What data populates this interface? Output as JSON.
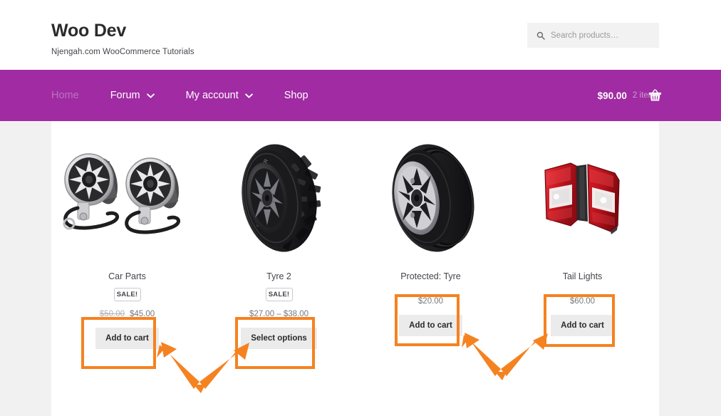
{
  "header": {
    "site_title": "Woo Dev",
    "tagline": "Njengah.com WooCommerce Tutorials",
    "search": {
      "icon": "search-icon",
      "placeholder": "Search products…",
      "value": ""
    }
  },
  "nav": {
    "background_color": "#a02ba3",
    "items": [
      {
        "label": "Home",
        "current": true,
        "has_dropdown": false
      },
      {
        "label": "Forum",
        "current": false,
        "has_dropdown": true
      },
      {
        "label": "My account",
        "current": false,
        "has_dropdown": true
      },
      {
        "label": "Shop",
        "current": false,
        "has_dropdown": false
      }
    ],
    "cart": {
      "amount": "$90.00",
      "count": "2 items",
      "icon": "shopping-basket-icon"
    }
  },
  "products": [
    {
      "title": "Car Parts",
      "image": "car-speakers",
      "on_sale": true,
      "sale_label": "SALE!",
      "price_old": "$50.00",
      "price": "$45.00",
      "button_label": "Add to cart"
    },
    {
      "title": "Tyre 2",
      "image": "offroad-tyre",
      "on_sale": true,
      "sale_label": "SALE!",
      "price_old": "",
      "price": "$27.00 – $38.00",
      "button_label": "Select options"
    },
    {
      "title": "Protected: Tyre",
      "image": "performance-tyre",
      "on_sale": false,
      "sale_label": "",
      "price_old": "",
      "price": "$20.00",
      "button_label": "Add to cart"
    },
    {
      "title": "Tail Lights",
      "image": "tail-lights",
      "on_sale": false,
      "sale_label": "",
      "price_old": "",
      "price": "$60.00",
      "button_label": "Add to cart"
    }
  ],
  "annotations": {
    "color": "#f58220",
    "highlight_boxes": [
      {
        "name": "highlight-car-parts-price-and-button"
      },
      {
        "name": "highlight-tyre2-price-and-button"
      },
      {
        "name": "highlight-protected-tyre-price-and-button"
      },
      {
        "name": "highlight-tail-lights-price-and-button"
      }
    ],
    "arrows": [
      {
        "name": "arrow-pair-left"
      },
      {
        "name": "arrow-pair-right"
      }
    ]
  }
}
